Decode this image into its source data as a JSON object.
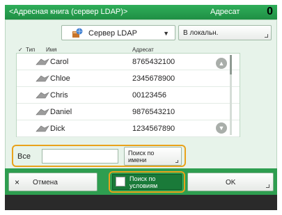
{
  "header": {
    "title": "<Адресная книга (сервер LDAP)>",
    "destination_label": "Адресат",
    "count": "0"
  },
  "selector": {
    "server_label": "Сервер LDAP",
    "local_button": "В локальн."
  },
  "table": {
    "columns": {
      "check": "✓",
      "type": "Тип",
      "name": "Имя",
      "address": "Адресат"
    },
    "rows": [
      {
        "name": "Carol",
        "address": "8765432100"
      },
      {
        "name": "Chloe",
        "address": "2345678900"
      },
      {
        "name": "Chris",
        "address": "00123456"
      },
      {
        "name": "Daniel",
        "address": "9876543210"
      },
      {
        "name": "Dick",
        "address": "1234567890"
      }
    ]
  },
  "search": {
    "all_label": "Все",
    "input_value": "",
    "search_by_name_line1": "Поиск по",
    "search_by_name_line2": "имени"
  },
  "actions": {
    "cancel_icon": "×",
    "cancel": "Отмена",
    "search_by_condition_line1": "Поиск по",
    "search_by_condition_line2": "условиям",
    "ok": "OK"
  },
  "icons": {
    "ldap-server": "server-globe-icon",
    "person": "person-icon",
    "scroll-up": "chevron-up-icon",
    "scroll-down": "chevron-down-icon"
  },
  "colors": {
    "header_green": "#1f8f44",
    "highlight_orange": "#e9a21b"
  }
}
